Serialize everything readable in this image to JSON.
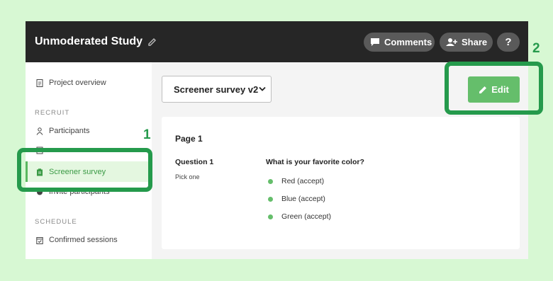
{
  "header": {
    "title": "Unmoderated Study",
    "comments_label": "Comments",
    "share_label": "Share",
    "help_label": "?"
  },
  "sidebar": {
    "project_overview": "Project overview",
    "recruit_heading": "RECRUIT",
    "participants": "Participants",
    "screener_survey": "Screener survey",
    "invite_participants": "Invite participants",
    "schedule_heading": "SCHEDULE",
    "confirmed_sessions": "Confirmed sessions"
  },
  "main": {
    "survey_select_value": "Screener survey v2",
    "edit_label": "Edit",
    "page_title": "Page 1",
    "question_label": "Question 1",
    "question_type": "Pick one",
    "question_text": "What is your favorite color?",
    "options": [
      "Red (accept)",
      "Blue (accept)",
      "Green (accept)"
    ]
  },
  "annotations": {
    "callout_1": "1",
    "callout_2": "2",
    "color": "#259a4c"
  },
  "colors": {
    "accent": "#65be6b",
    "topbar": "#262626",
    "background": "#d7f8d3"
  }
}
